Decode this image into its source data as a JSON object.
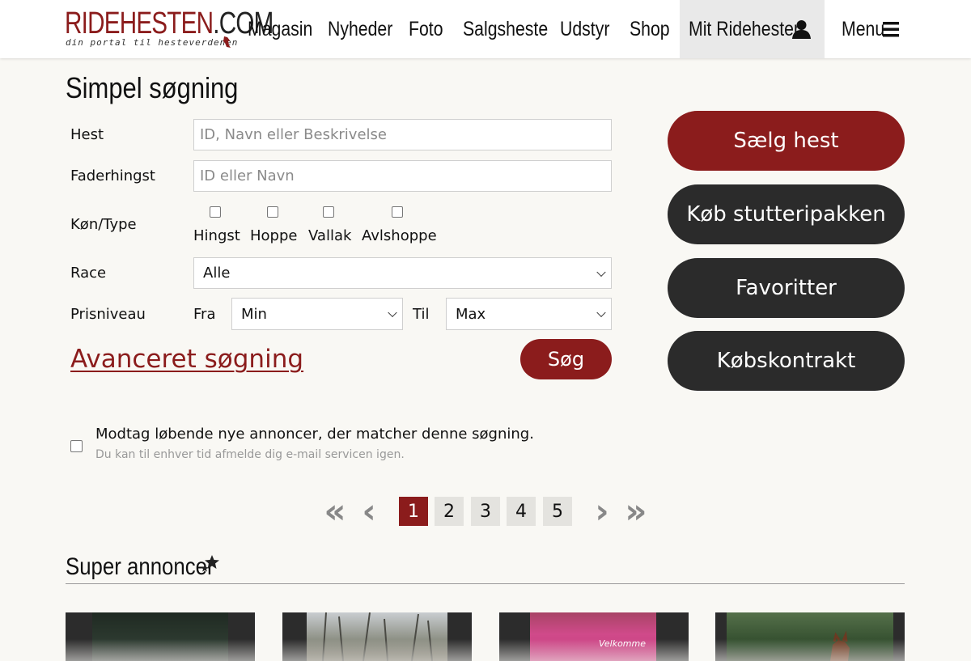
{
  "header": {
    "logo_main_red": "RIDEHESTEN",
    "logo_main_dark": ".COM",
    "logo_tagline": "din portal til hesteverdenen",
    "nav": [
      "Magasin",
      "Nyheder",
      "Foto",
      "Salgsheste",
      "Udstyr",
      "Shop"
    ],
    "account_label": "Mit Ridehesten",
    "menu_label": "Menu"
  },
  "form": {
    "title": "Simpel søgning",
    "horse_label": "Hest",
    "horse_placeholder": "ID, Navn eller Beskrivelse",
    "sire_label": "Faderhingst",
    "sire_placeholder": "ID eller Navn",
    "gender_label": "Køn/Type",
    "gender_options": [
      "Hingst",
      "Hoppe",
      "Vallak",
      "Avlshoppe"
    ],
    "race_label": "Race",
    "race_value": "Alle",
    "price_label": "Prisniveau",
    "from_label": "Fra",
    "min_value": "Min",
    "to_label": "Til",
    "max_value": "Max",
    "advanced_link": "Avanceret søgning",
    "search_button": "Søg"
  },
  "side_buttons": [
    "Sælg hest",
    "Køb stutteripakken",
    "Favoritter",
    "Købskontrakt"
  ],
  "colors": {
    "brand_red": "#8b1c1c",
    "dark_button": "#2b2b2b",
    "background": "#f9f8f4"
  },
  "notify": {
    "main": "Modtag løbende nye annoncer, der matcher denne søgning.",
    "sub": "Du kan til enhver tid afmelde dig e-mail servicen igen."
  },
  "pagination": {
    "pages": [
      "1",
      "2",
      "3",
      "4",
      "5"
    ],
    "current": "1"
  },
  "super": {
    "title": "Super annoncer",
    "thumb_text_3": "Velkomme"
  }
}
